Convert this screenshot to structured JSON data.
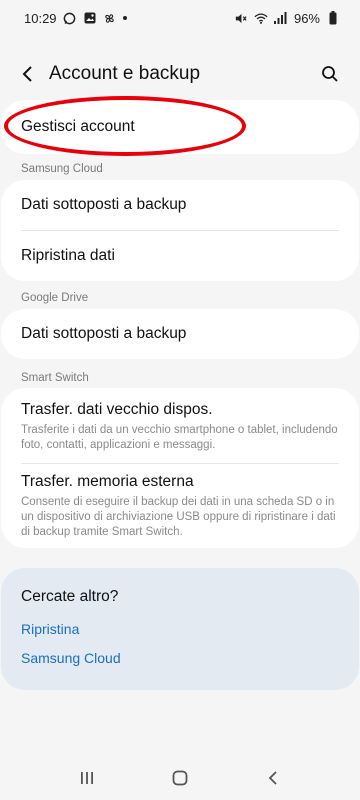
{
  "status_bar": {
    "time": "10:29",
    "battery": "96%",
    "left_icons": [
      "whatsapp-icon",
      "gallery-icon",
      "pinwheel-icon"
    ],
    "right_icons": [
      "mute-icon",
      "wifi-icon",
      "signal-icon",
      "battery-icon"
    ]
  },
  "header": {
    "title": "Account e backup",
    "back_icon": "back-arrow-icon",
    "search_icon": "search-icon"
  },
  "manage": {
    "label": "Gestisci account",
    "highlight_color": "#e8000b"
  },
  "samsung_cloud": {
    "section": "Samsung Cloud",
    "items": [
      {
        "label": "Dati sottoposti a backup"
      },
      {
        "label": "Ripristina dati"
      }
    ]
  },
  "google_drive": {
    "section": "Google Drive",
    "items": [
      {
        "label": "Dati sottoposti a backup"
      }
    ]
  },
  "smart_switch": {
    "section": "Smart Switch",
    "items": [
      {
        "label": "Trasfer. dati vecchio dispos.",
        "desc": "Trasferite i dati da un vecchio smartphone o tablet, includendo foto, contatti, applicazioni e messaggi."
      },
      {
        "label": "Trasfer. memoria esterna",
        "desc": "Consente di eseguire il backup dei dati in una scheda SD o in un dispositivo di archiviazione USB oppure di ripristinare i dati di backup tramite Smart Switch."
      }
    ]
  },
  "more": {
    "title": "Cercate altro?",
    "links": [
      "Ripristina",
      "Samsung Cloud"
    ]
  },
  "navbar": {
    "icons": [
      "recent-apps-icon",
      "home-icon",
      "back-icon"
    ]
  },
  "colors": {
    "background": "#f5f5f5",
    "card": "#ffffff",
    "link": "#1a6fc2",
    "more_card": "#e3eaf2"
  }
}
